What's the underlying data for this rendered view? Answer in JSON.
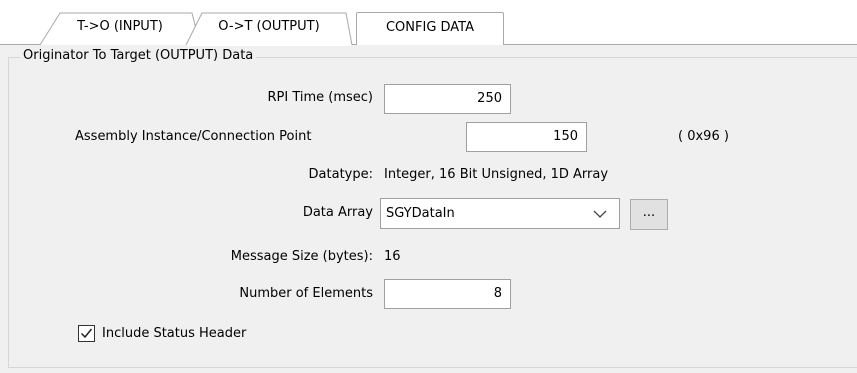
{
  "tabs": [
    {
      "label": "T->O (INPUT)",
      "active": false
    },
    {
      "label": "O->T (OUTPUT)",
      "active": true
    },
    {
      "label": "CONFIG DATA",
      "active": false
    }
  ],
  "group": {
    "title": "Originator To Target (OUTPUT) Data"
  },
  "fields": {
    "rpi_label": "RPI Time (msec)",
    "rpi_value": "250",
    "assembly_label": "Assembly Instance/Connection Point",
    "assembly_value": "150",
    "assembly_hex": "( 0x96 )",
    "datatype_label": "Datatype:",
    "datatype_value": "Integer, 16 Bit Unsigned, 1D Array",
    "data_array_label": "Data Array",
    "data_array_value": "SGYDataIn",
    "ellipsis_label": "...",
    "message_size_label": "Message Size (bytes):",
    "message_size_value": "16",
    "num_elements_label": "Number of Elements",
    "num_elements_value": "8"
  },
  "include_status_header": {
    "label": "Include Status Header",
    "checked": true
  },
  "icons": {
    "dropdown": "chevron-down-icon",
    "checkbox": "checkmark-icon"
  }
}
